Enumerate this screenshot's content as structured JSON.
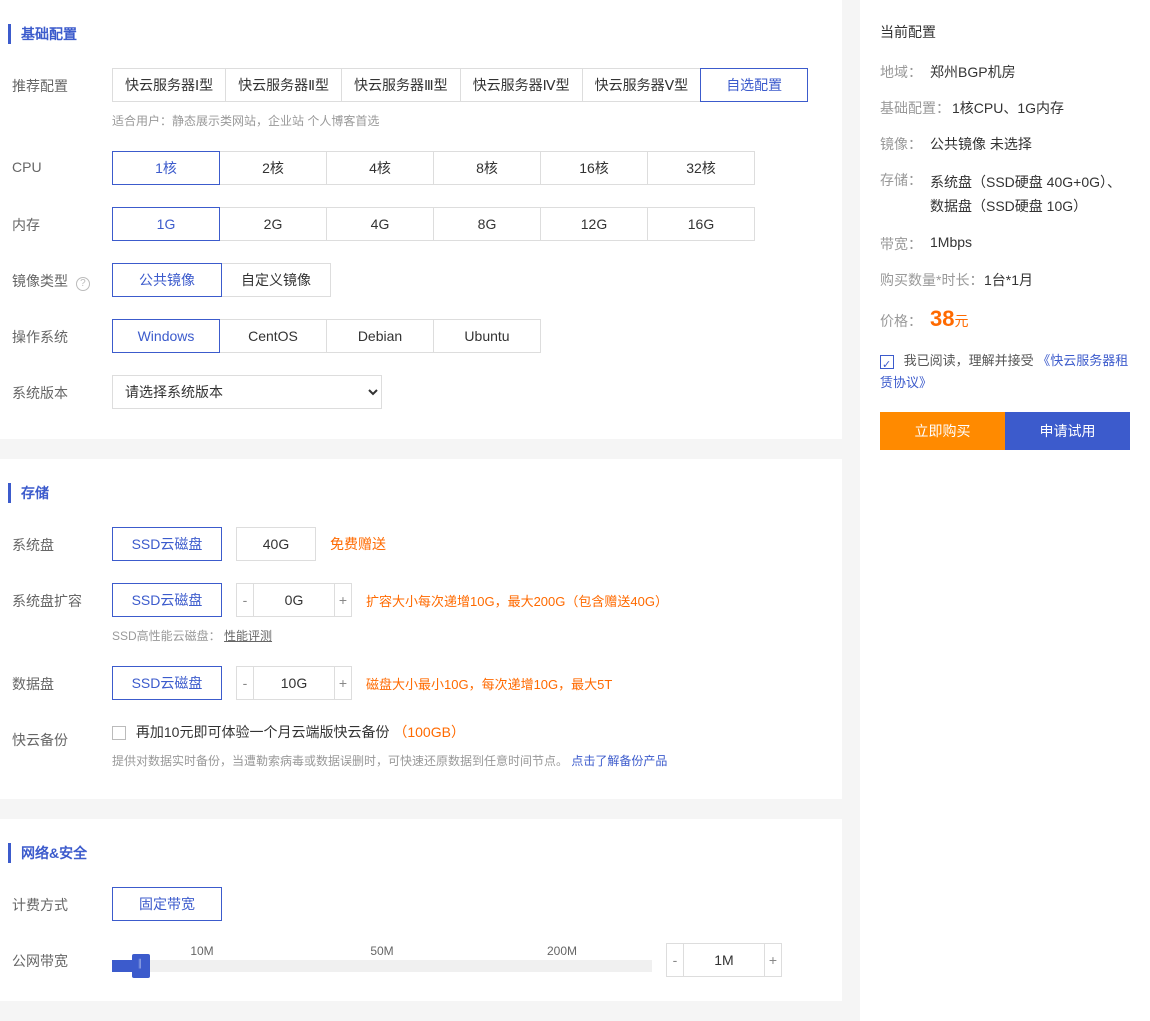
{
  "sections": {
    "basic": "基础配置",
    "storage": "存储",
    "network": "网络&安全"
  },
  "labels": {
    "recommend": "推荐配置",
    "cpu": "CPU",
    "memory": "内存",
    "image_type": "镜像类型",
    "os": "操作系统",
    "version": "系统版本",
    "sys_disk": "系统盘",
    "sys_disk_expand": "系统盘扩容",
    "data_disk": "数据盘",
    "backup": "快云备份",
    "billing": "计费方式",
    "bandwidth": "公网带宽"
  },
  "recommend": {
    "options": [
      "快云服务器Ⅰ型",
      "快云服务器Ⅱ型",
      "快云服务器Ⅲ型",
      "快云服务器Ⅳ型",
      "快云服务器Ⅴ型",
      "自选配置"
    ],
    "selected": "自选配置",
    "hint": "适合用户：静态展示类网站，企业站 个人博客首选"
  },
  "cpu": {
    "options": [
      "1核",
      "2核",
      "4核",
      "8核",
      "16核",
      "32核"
    ],
    "selected": "1核"
  },
  "memory": {
    "options": [
      "1G",
      "2G",
      "4G",
      "8G",
      "12G",
      "16G"
    ],
    "selected": "1G"
  },
  "image": {
    "options": [
      "公共镜像",
      "自定义镜像"
    ],
    "selected": "公共镜像",
    "help": "?"
  },
  "os": {
    "options": [
      "Windows",
      "CentOS",
      "Debian",
      "Ubuntu"
    ],
    "selected": "Windows"
  },
  "version": {
    "placeholder": "请选择系统版本"
  },
  "sys_disk": {
    "type": "SSD云磁盘",
    "size": "40G",
    "note": "免费赠送"
  },
  "sys_disk_expand": {
    "type": "SSD云磁盘",
    "value": "0G",
    "note": "扩容大小每次递增10G，最大200G（包含赠送40G）",
    "perf_label": "SSD高性能云磁盘：",
    "perf_link": "性能评测"
  },
  "data_disk": {
    "type": "SSD云磁盘",
    "value": "10G",
    "note": "磁盘大小最小10G，每次递增10G，最大5T"
  },
  "backup": {
    "check_label": "再加10元即可体验一个月云端版快云备份",
    "check_suffix": "（100GB）",
    "desc": "提供对数据实时备份，当遭勒索病毒或数据误删时，可快速还原数据到任意时间节点。",
    "link": "点击了解备份产品"
  },
  "billing": {
    "options": [
      "固定带宽"
    ],
    "selected": "固定带宽"
  },
  "bandwidth": {
    "marks": [
      "10M",
      "50M",
      "200M"
    ],
    "value": "1M"
  },
  "side": {
    "title": "当前配置",
    "items": {
      "region_k": "地域：",
      "region_v": "郑州BGP机房",
      "basic_k": "基础配置：",
      "basic_v": "1核CPU、1G内存",
      "image_k": "镜像：",
      "image_v": "公共镜像 未选择",
      "storage_k": "存储：",
      "storage_v": "系统盘（SSD硬盘 40G+0G）、 数据盘（SSD硬盘 10G）",
      "bw_k": "带宽：",
      "bw_v": "1Mbps",
      "qty_k": "购买数量*时长：",
      "qty_v": "1台*1月",
      "price_k": "价格：",
      "price_v": "38",
      "price_u": "元"
    },
    "agree_pre": "我已阅读，理解并接受",
    "agree_link": "《快云服务器租赁协议》",
    "buy": "立即购买",
    "trial": "申请试用"
  }
}
